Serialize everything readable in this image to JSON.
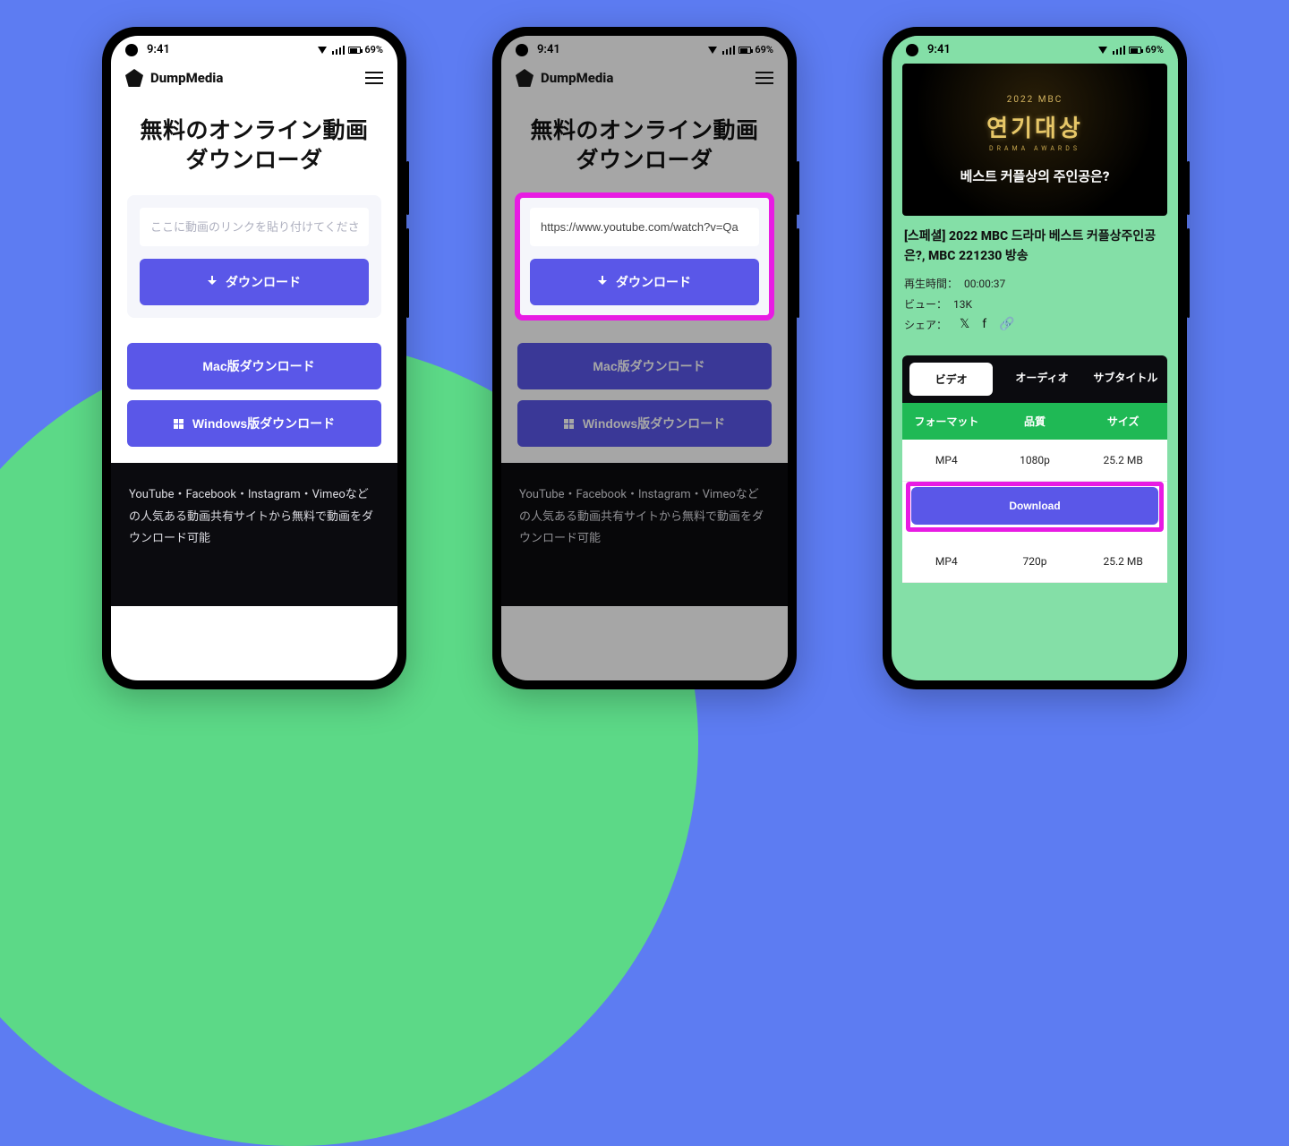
{
  "status": {
    "time": "9:41",
    "battery": "69%"
  },
  "brand": "DumpMedia",
  "hero": {
    "title": "無料のオンライン動画ダウンローダ"
  },
  "input": {
    "placeholder": "ここに動画のリンクを貼り付けてください",
    "value": "https://www.youtube.com/watch?v=Qa"
  },
  "buttons": {
    "download": "ダウンロード",
    "mac": "Mac版ダウンロード",
    "windows": "Windows版ダウンロード"
  },
  "footer": "YouTube・Facebook・Instagram・Vimeoなどの人気ある動画共有サイトから無料で動画をダウンロード可能",
  "result": {
    "thumb": {
      "year": "2022 MBC",
      "main": "연기대상",
      "sub": "DRAMA AWARDS",
      "caption": "베스트 커플상의 주인공은?"
    },
    "title": "[스페셜] 2022 MBC 드라마 베스트 커플상주인공은?, MBC 221230 방송",
    "duration_label": "再生時間：",
    "duration": "00:00:37",
    "views_label": "ビュー：",
    "views": "13K",
    "share_label": "シェア：",
    "tabs": {
      "video": "ビデオ",
      "audio": "オーディオ",
      "subtitle": "サブタイトル"
    },
    "table": {
      "format": "フォーマット",
      "quality": "品質",
      "size": "サイズ",
      "rows": [
        {
          "format": "MP4",
          "quality": "1080p",
          "size": "25.2 MB"
        },
        {
          "format": "MP4",
          "quality": "720p",
          "size": "25.2 MB"
        }
      ],
      "download_btn": "Download"
    }
  }
}
